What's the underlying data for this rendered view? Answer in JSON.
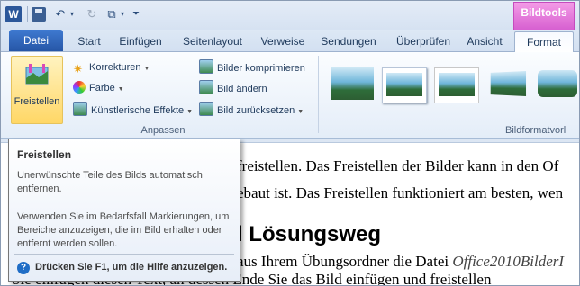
{
  "qat": {
    "word_icon": "W",
    "icons": [
      "save-icon",
      "undo-icon",
      "redo-icon",
      "customize-icon"
    ]
  },
  "context_tab": "Bildtools",
  "tabs": [
    "Datei",
    "Start",
    "Einfügen",
    "Seitenlayout",
    "Verweise",
    "Sendungen",
    "Überprüfen",
    "Ansicht",
    "Format"
  ],
  "ribbon": {
    "freistellen": "Freistellen",
    "korrekturen": "Korrekturen",
    "farbe": "Farbe",
    "kuenstlerische": "Künstlerische Effekte",
    "komprimieren": "Bilder komprimieren",
    "aendern": "Bild ändern",
    "zuruecksetzen": "Bild zurücksetzen",
    "group_anpassen": "Anpassen",
    "group_bildformat": "Bildformatvorl"
  },
  "document": {
    "line1": "freistellen. Das Freistellen der Bilder kann in den Of",
    "line2": "ebaut ist. Das Freistellen funktioniert am besten, wen",
    "heading": "l Lösungsweg",
    "line3_a": "aus Ihrem Übungsordner die Datei ",
    "line3_b": "Office2010BilderI",
    "line4": "Sie einfügen diesen Text, an dessen Ende Sie das Bild einfügen und freistellen"
  },
  "tooltip": {
    "title": "Freistellen",
    "para1": "Unerwünschte Teile des Bilds automatisch entfernen.",
    "para2": "Verwenden Sie im Bedarfsfall Markierungen, um Bereiche anzuzeigen, die im Bild erhalten oder entfernt werden sollen.",
    "help_symbol": "?",
    "help": "Drücken Sie F1, um die Hilfe anzuzeigen."
  },
  "colors": {
    "file_tab": "#2656a6",
    "context_tab": "#d65ed0",
    "highlight": "#ffd766"
  }
}
